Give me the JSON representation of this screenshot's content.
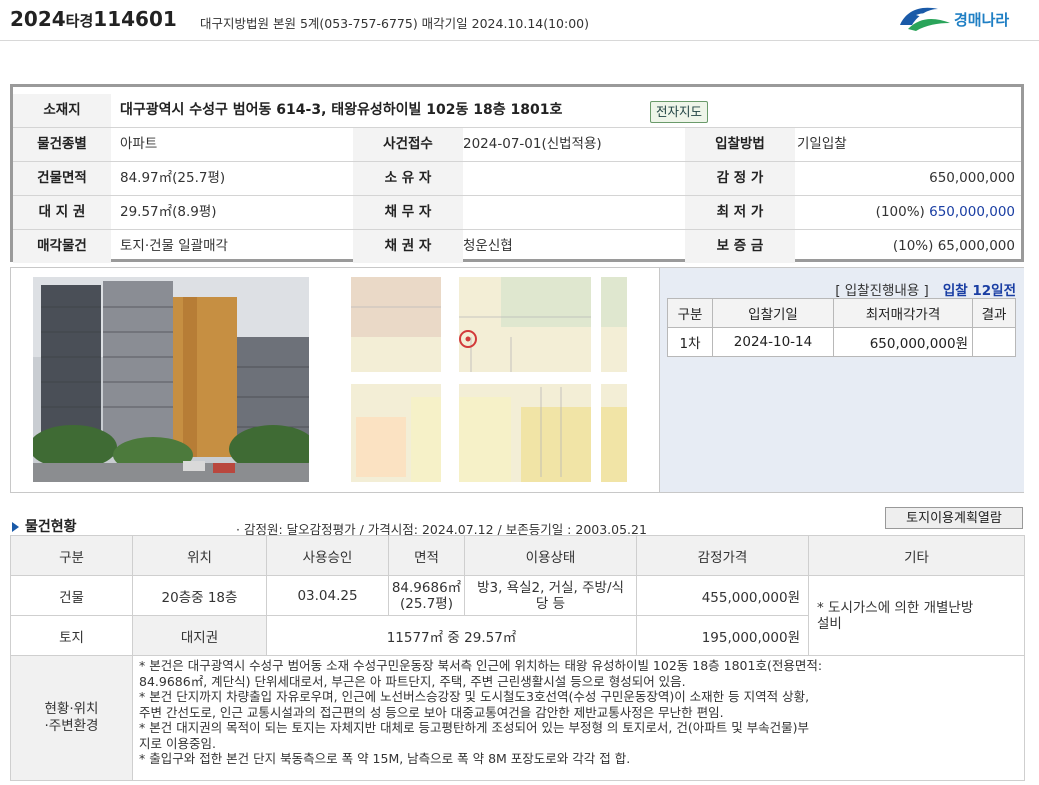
{
  "header": {
    "case_year": "2024",
    "case_type": "타경",
    "case_no": "114601",
    "court_info": "대구지방법원 본원 5계(053-757-6775) 매각기일 2024.10.14(10:00)",
    "logo_text": "경매나라"
  },
  "summary": {
    "location_label": "소재지",
    "location_value": "대구광역시 수성구 범어동 614-3, 태왕유성하이빌 102동 18층 1801호",
    "map_button": "전자지도",
    "type_label": "물건종별",
    "type_value": "아파트",
    "case_receipt_label": "사건접수",
    "case_receipt_value": "2024-07-01(신법적용)",
    "bid_method_label": "입찰방법",
    "bid_method_value": "기일입찰",
    "building_area_label": "건물면적",
    "building_area_value": "84.97㎡(25.7평)",
    "owner_label": "소 유 자",
    "owner_value": "",
    "appraisal_label": "감 정 가",
    "appraisal_value": "650,000,000",
    "land_right_label": "대 지 권",
    "land_right_value": "29.57㎡(8.9평)",
    "debtor_label": "채 무 자",
    "debtor_value": "",
    "min_price_label": "최 저 가",
    "min_price_pct": "(100%)",
    "min_price_value": "650,000,000",
    "sale_item_label": "매각물건",
    "sale_item_value": "토지·건물 일괄매각",
    "creditor_label": "채 권 자",
    "creditor_value": "청운신협",
    "deposit_label": "보 증 금",
    "deposit_value": "(10%) 65,000,000"
  },
  "bid": {
    "title": "[ 입찰진행내용 ]",
    "dday": "입찰 12일전",
    "headers": [
      "구분",
      "입찰기일",
      "최저매각가격",
      "결과"
    ],
    "rows": [
      {
        "round": "1차",
        "date": "2024-10-14",
        "price": "650,000,000원",
        "result": ""
      }
    ]
  },
  "status": {
    "section_title": "물건현황",
    "appraisal_info": "· 감정원: 달오감정평가 / 가격시점: 2024.07.12 / 보존등기일 : 2003.05.21",
    "land_plan_button": "토지이용계획열람",
    "headers": [
      "구분",
      "위치",
      "사용승인",
      "면적",
      "이용상태",
      "감정가격",
      "기타"
    ],
    "building": {
      "label": "건물",
      "location": "20층중 18층",
      "approval": "03.04.25",
      "area_line1": "84.9686㎡",
      "area_line2": "(25.7평)",
      "usage_line1": "방3, 욕실2, 거실, 주방/식",
      "usage_line2": "당 등",
      "price": "455,000,000원"
    },
    "land": {
      "label": "토지",
      "location": "대지권",
      "area": "11577㎡ 중 29.57㎡",
      "price": "195,000,000원"
    },
    "other_line1": "* 도시가스에 의한 개별난방",
    "other_line2": "설비",
    "env_label_line1": "현황·위치",
    "env_label_line2": "·주변환경",
    "env_lines": [
      "* 본건은 대구광역시 수성구 범어동 소재 수성구민운동장 북서측 인근에 위치하는 태왕 유성하이빌 102동 18층 1801호(전용면적:",
      "84.9686㎡, 계단식) 단위세대로서, 부근은 아 파트단지, 주택, 주변 근린생활시설 등으로 형성되어 있음.",
      "* 본건 단지까지 차량출입 자유로우며, 인근에 노선버스승강장 및 도시철도3호선역(수성 구민운동장역)이 소재한 등 지역적 상황,",
      "주변 간선도로, 인근 교통시설과의 접근편의 성 등으로 보아 대중교통여건을 감안한 제반교통사정은 무난한 편임.",
      "* 본건 대지권의 목적이 되는 토지는 자체지반 대체로 등고평탄하게 조성되어 있는 부정형 의 토지로서, 건(아파트 및 부속건물)부",
      "지로 이용중임.",
      "* 출입구와 접한 본건 단지 북동측으로 폭 약 15M, 남측으로 폭 약 8M 포장도로와 각각 접 합."
    ]
  }
}
